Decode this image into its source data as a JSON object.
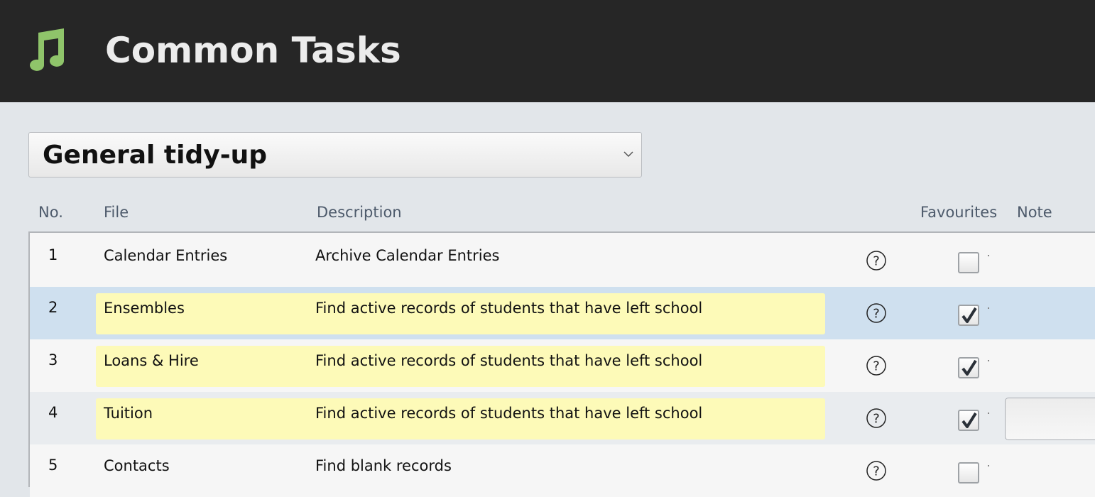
{
  "header": {
    "title": "Common Tasks",
    "logo_icon": "music-note-icon",
    "logo_color": "#8fc46a",
    "background": "#262626"
  },
  "task_select": {
    "selected": "General tidy-up"
  },
  "columns": {
    "no": "No.",
    "file": "File",
    "description": "Description",
    "favourites": "Favourites",
    "note": "Note"
  },
  "rows": [
    {
      "no": "1",
      "file": "Calendar Entries",
      "description": "Archive Calendar Entries",
      "favourite": false,
      "highlighted": false
    },
    {
      "no": "2",
      "file": "Ensembles",
      "description": "Find active records of students that have left school",
      "favourite": true,
      "highlighted": true,
      "selected": true
    },
    {
      "no": "3",
      "file": "Loans & Hire",
      "description": "Find active records of students that have left school",
      "favourite": true,
      "highlighted": true
    },
    {
      "no": "4",
      "file": "Tuition",
      "description": "Find active records of students that have left school",
      "favourite": true,
      "highlighted": true,
      "note": ""
    },
    {
      "no": "5",
      "file": "Contacts",
      "description": "Find blank records",
      "favourite": false,
      "highlighted": false
    }
  ],
  "colors": {
    "selected_row": "#cfe0ef",
    "highlight": "#fdfab8",
    "header_text": "#4d5a6b"
  }
}
